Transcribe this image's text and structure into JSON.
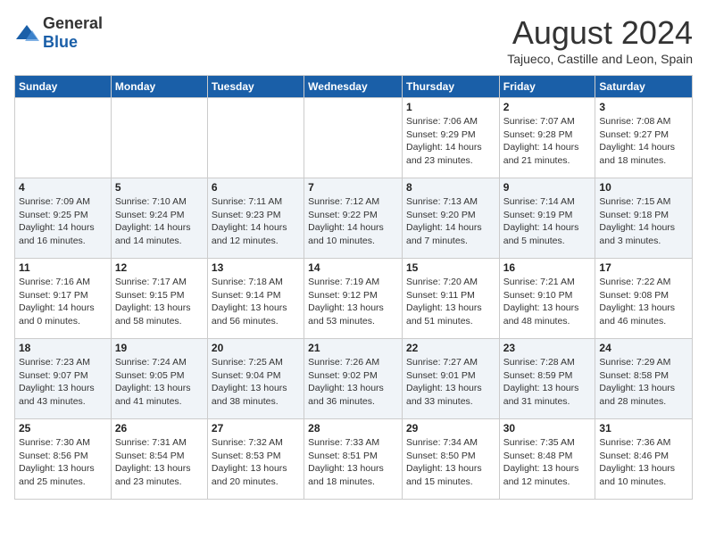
{
  "logo": {
    "general": "General",
    "blue": "Blue"
  },
  "title": {
    "month_year": "August 2024",
    "location": "Tajueco, Castille and Leon, Spain"
  },
  "weekdays": [
    "Sunday",
    "Monday",
    "Tuesday",
    "Wednesday",
    "Thursday",
    "Friday",
    "Saturday"
  ],
  "weeks": [
    [
      {
        "day": "",
        "info": ""
      },
      {
        "day": "",
        "info": ""
      },
      {
        "day": "",
        "info": ""
      },
      {
        "day": "",
        "info": ""
      },
      {
        "day": "1",
        "info": "Sunrise: 7:06 AM\nSunset: 9:29 PM\nDaylight: 14 hours\nand 23 minutes."
      },
      {
        "day": "2",
        "info": "Sunrise: 7:07 AM\nSunset: 9:28 PM\nDaylight: 14 hours\nand 21 minutes."
      },
      {
        "day": "3",
        "info": "Sunrise: 7:08 AM\nSunset: 9:27 PM\nDaylight: 14 hours\nand 18 minutes."
      }
    ],
    [
      {
        "day": "4",
        "info": "Sunrise: 7:09 AM\nSunset: 9:25 PM\nDaylight: 14 hours\nand 16 minutes."
      },
      {
        "day": "5",
        "info": "Sunrise: 7:10 AM\nSunset: 9:24 PM\nDaylight: 14 hours\nand 14 minutes."
      },
      {
        "day": "6",
        "info": "Sunrise: 7:11 AM\nSunset: 9:23 PM\nDaylight: 14 hours\nand 12 minutes."
      },
      {
        "day": "7",
        "info": "Sunrise: 7:12 AM\nSunset: 9:22 PM\nDaylight: 14 hours\nand 10 minutes."
      },
      {
        "day": "8",
        "info": "Sunrise: 7:13 AM\nSunset: 9:20 PM\nDaylight: 14 hours\nand 7 minutes."
      },
      {
        "day": "9",
        "info": "Sunrise: 7:14 AM\nSunset: 9:19 PM\nDaylight: 14 hours\nand 5 minutes."
      },
      {
        "day": "10",
        "info": "Sunrise: 7:15 AM\nSunset: 9:18 PM\nDaylight: 14 hours\nand 3 minutes."
      }
    ],
    [
      {
        "day": "11",
        "info": "Sunrise: 7:16 AM\nSunset: 9:17 PM\nDaylight: 14 hours\nand 0 minutes."
      },
      {
        "day": "12",
        "info": "Sunrise: 7:17 AM\nSunset: 9:15 PM\nDaylight: 13 hours\nand 58 minutes."
      },
      {
        "day": "13",
        "info": "Sunrise: 7:18 AM\nSunset: 9:14 PM\nDaylight: 13 hours\nand 56 minutes."
      },
      {
        "day": "14",
        "info": "Sunrise: 7:19 AM\nSunset: 9:12 PM\nDaylight: 13 hours\nand 53 minutes."
      },
      {
        "day": "15",
        "info": "Sunrise: 7:20 AM\nSunset: 9:11 PM\nDaylight: 13 hours\nand 51 minutes."
      },
      {
        "day": "16",
        "info": "Sunrise: 7:21 AM\nSunset: 9:10 PM\nDaylight: 13 hours\nand 48 minutes."
      },
      {
        "day": "17",
        "info": "Sunrise: 7:22 AM\nSunset: 9:08 PM\nDaylight: 13 hours\nand 46 minutes."
      }
    ],
    [
      {
        "day": "18",
        "info": "Sunrise: 7:23 AM\nSunset: 9:07 PM\nDaylight: 13 hours\nand 43 minutes."
      },
      {
        "day": "19",
        "info": "Sunrise: 7:24 AM\nSunset: 9:05 PM\nDaylight: 13 hours\nand 41 minutes."
      },
      {
        "day": "20",
        "info": "Sunrise: 7:25 AM\nSunset: 9:04 PM\nDaylight: 13 hours\nand 38 minutes."
      },
      {
        "day": "21",
        "info": "Sunrise: 7:26 AM\nSunset: 9:02 PM\nDaylight: 13 hours\nand 36 minutes."
      },
      {
        "day": "22",
        "info": "Sunrise: 7:27 AM\nSunset: 9:01 PM\nDaylight: 13 hours\nand 33 minutes."
      },
      {
        "day": "23",
        "info": "Sunrise: 7:28 AM\nSunset: 8:59 PM\nDaylight: 13 hours\nand 31 minutes."
      },
      {
        "day": "24",
        "info": "Sunrise: 7:29 AM\nSunset: 8:58 PM\nDaylight: 13 hours\nand 28 minutes."
      }
    ],
    [
      {
        "day": "25",
        "info": "Sunrise: 7:30 AM\nSunset: 8:56 PM\nDaylight: 13 hours\nand 25 minutes."
      },
      {
        "day": "26",
        "info": "Sunrise: 7:31 AM\nSunset: 8:54 PM\nDaylight: 13 hours\nand 23 minutes."
      },
      {
        "day": "27",
        "info": "Sunrise: 7:32 AM\nSunset: 8:53 PM\nDaylight: 13 hours\nand 20 minutes."
      },
      {
        "day": "28",
        "info": "Sunrise: 7:33 AM\nSunset: 8:51 PM\nDaylight: 13 hours\nand 18 minutes."
      },
      {
        "day": "29",
        "info": "Sunrise: 7:34 AM\nSunset: 8:50 PM\nDaylight: 13 hours\nand 15 minutes."
      },
      {
        "day": "30",
        "info": "Sunrise: 7:35 AM\nSunset: 8:48 PM\nDaylight: 13 hours\nand 12 minutes."
      },
      {
        "day": "31",
        "info": "Sunrise: 7:36 AM\nSunset: 8:46 PM\nDaylight: 13 hours\nand 10 minutes."
      }
    ]
  ]
}
